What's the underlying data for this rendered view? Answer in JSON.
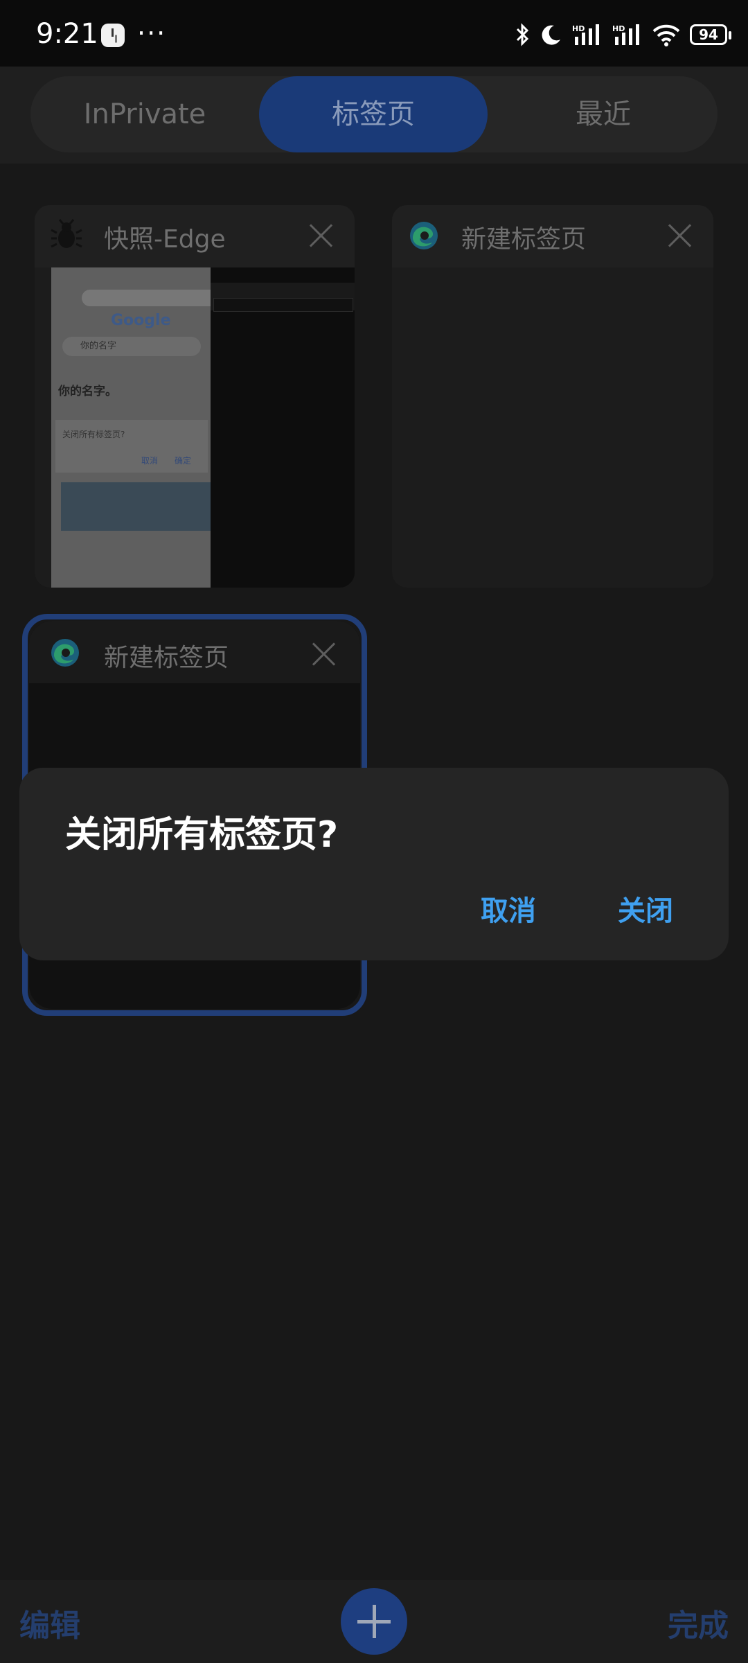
{
  "status_bar": {
    "time": "9:21",
    "more": "···",
    "battery": "94",
    "icons": [
      "bluetooth-icon",
      "moon-icon",
      "hd-signal-icon",
      "hd-signal-icon",
      "wifi-icon"
    ]
  },
  "tab_switcher": {
    "segments": [
      {
        "label": "InPrivate",
        "selected": false
      },
      {
        "label": "标签页",
        "selected": true
      },
      {
        "label": "最近",
        "selected": false
      }
    ]
  },
  "tabs": [
    {
      "title": "快照-Edge",
      "icon": "bug-icon",
      "preview": {
        "google": "Google",
        "search": "你的名字",
        "heading": "你的名字。",
        "dialog_text": "关闭所有标签页?",
        "dialog_cancel": "取消",
        "dialog_ok": "确定"
      }
    },
    {
      "title": "新建标签页",
      "icon": "edge-icon"
    },
    {
      "title": "新建标签页",
      "icon": "edge-icon",
      "active": true
    }
  ],
  "dialog": {
    "title": "关闭所有标签页?",
    "cancel": "取消",
    "confirm": "关闭"
  },
  "bottom_bar": {
    "edit": "编辑",
    "done": "完成"
  },
  "colors": {
    "accent_blue": "#3fa0f0",
    "selected_segment": "#1a3a78",
    "background": "#181818"
  }
}
